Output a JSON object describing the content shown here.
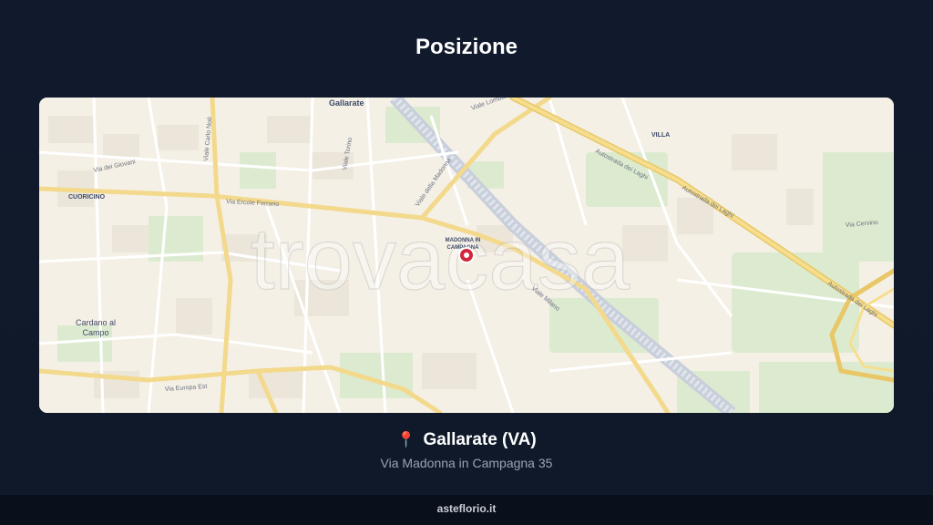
{
  "header": {
    "title": "Posizione"
  },
  "map": {
    "watermark": "trovacasa",
    "marker_icon": "map-marker-icon",
    "marker_color": "#d1263b",
    "labels": {
      "gallarate": "Gallarate",
      "villa": "VILLA",
      "cuoricino": "CUORICINO",
      "madonna_line1": "MADONNA IN",
      "madonna_line2": "CAMPAGNA",
      "cardano_line1": "Cardano al",
      "cardano_line2": "Campo"
    },
    "streets": {
      "ercole_ferrario": "Via Ercole Ferrario",
      "autostrada_1": "Autostrada dei Laghi",
      "autostrada_2": "Autostrada dei Laghi",
      "autostrada_3": "Autostrada dei Laghi",
      "europa_est": "Via Europa Est",
      "milano": "Viale Milano",
      "della_madonna": "Viale della Madonna",
      "lombardia": "Viale Lombardia",
      "carlo_noe": "Viale Carlo Noè",
      "dei_giovani": "Via dei Giovani",
      "cervino": "Via Cervino",
      "torino": "Viale Torino"
    }
  },
  "location": {
    "pin_icon": "pin-icon",
    "city": "Gallarate (VA)",
    "address": "Via Madonna in Campagna 35"
  },
  "footer": {
    "brand": "asteflorio.it"
  }
}
